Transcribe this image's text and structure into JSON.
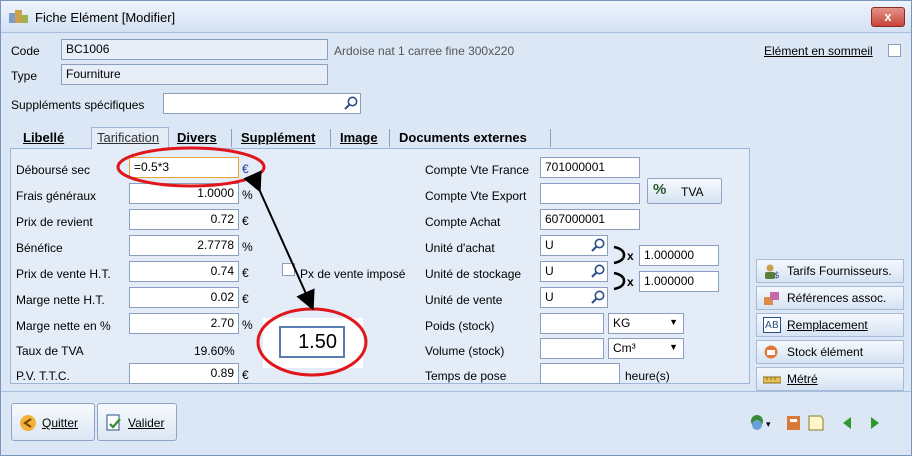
{
  "window": {
    "title": "Fiche Elément [Modifier]",
    "close_label": "x"
  },
  "header": {
    "code_label": "Code",
    "code_value": "BC1006",
    "description": "Ardoise nat 1 carree fine 300x220",
    "type_label": "Type",
    "type_value": "Fourniture",
    "sommeil_label": "Elément en sommeil",
    "supplements_label": "Suppléments spécifiques",
    "supplements_value": ""
  },
  "tabs": [
    "Libellé",
    "Tarification",
    "Divers",
    "Supplément",
    "Image",
    "Documents externes"
  ],
  "pricing": {
    "debourse_label": "Déboursé sec",
    "debourse_value": "=0.5*3",
    "debourse_unit": "€",
    "frais_label": "Frais généraux",
    "frais_value": "1.0000",
    "frais_unit": "%",
    "revient_label": "Prix de revient",
    "revient_value": "0.72",
    "revient_unit": "€",
    "benefice_label": "Bénéfice",
    "benefice_value": "2.7778",
    "benefice_unit": "%",
    "pv_ht_label": "Prix de vente H.T.",
    "pv_ht_value": "0.74",
    "pv_ht_unit": "€",
    "marge_label": "Marge nette H.T.",
    "marge_value": "0.02",
    "marge_unit": "€",
    "marge_pct_label": "Marge nette en %",
    "marge_pct_value": "2.70",
    "marge_pct_unit": "%",
    "tva_label": "Taux de TVA",
    "tva_value": "19.60%",
    "pvttc_label": "P.V. T.T.C.",
    "pvttc_value": "0.89",
    "pvttc_unit": "€",
    "px_impose_label": "Px de vente imposé",
    "callout_value": "1.50"
  },
  "accounts": {
    "vte_france_label": "Compte Vte France",
    "vte_france_value": "701000001",
    "vte_export_label": "Compte Vte Export",
    "vte_export_value": "",
    "achat_label": "Compte Achat",
    "achat_value": "607000001",
    "tva_button": "TVA",
    "tva_icon_text": "%",
    "unite_achat_label": "Unité d'achat",
    "unite_achat_value": "U",
    "unite_stock_label": "Unité de stockage",
    "unite_stock_value": "U",
    "unite_vente_label": "Unité de vente",
    "unite_vente_value": "U",
    "coef1": "1.000000",
    "coef2": "1.000000",
    "mult_sign": "x",
    "poids_label": "Poids (stock)",
    "poids_value": "",
    "poids_unit": "KG",
    "volume_label": "Volume (stock)",
    "volume_value": "",
    "volume_unit": "Cm³",
    "pose_label": "Temps de pose",
    "pose_value": "",
    "pose_unit": "heure(s)"
  },
  "side_buttons": [
    "Tarifs Fournisseurs.",
    "Références assoc.",
    "Remplacement",
    "Stock élément",
    "Métré"
  ],
  "footer": {
    "quit": "Quitter",
    "validate": "Valider"
  },
  "colors": {
    "annotation": "#e0161b",
    "arrow": "#000000",
    "accent": "#4f74b0"
  }
}
